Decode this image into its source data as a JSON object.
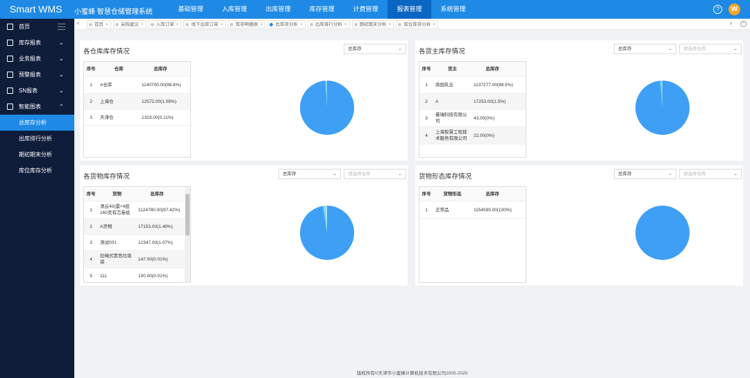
{
  "header": {
    "logo": "Smart WMS",
    "subtitle": "小蜜蜂 智慧仓储管理系统",
    "nav": [
      "基础管理",
      "入库管理",
      "出库管理",
      "库存管理",
      "计费管理",
      "报表管理",
      "系统管理"
    ],
    "active_nav_index": 5,
    "help_icon": "?",
    "avatar_letter": "W"
  },
  "sidebar": {
    "items": [
      {
        "label": "首页",
        "icon": "dashboard-icon"
      },
      {
        "label": "库存报表",
        "icon": "report-icon",
        "arrow": "⌄"
      },
      {
        "label": "业务报表",
        "icon": "business-icon",
        "arrow": "⌄"
      },
      {
        "label": "预警报表",
        "icon": "warning-icon",
        "arrow": "⌄"
      },
      {
        "label": "SN报表",
        "icon": "sn-icon",
        "arrow": "⌄"
      },
      {
        "label": "智能图表",
        "icon": "chart-icon",
        "arrow": "⌃"
      }
    ],
    "subitems": [
      "总库存分析",
      "出库排行分析",
      "期初期末分析",
      "库位库存分析"
    ],
    "active_sub_index": 0
  },
  "tabs": {
    "items": [
      "首页",
      "采购建议",
      "入库订单",
      "线下出库订单",
      "库存明细表",
      "总库存分析",
      "出库排行分析",
      "期初期末分析",
      "库位库存分析"
    ],
    "active_index": 5,
    "close": "×",
    "left": "‹",
    "right": "›"
  },
  "panels": {
    "warehouse": {
      "title": "各仓库库存情况",
      "select": "总库存",
      "headers": [
        "序号",
        "仓库",
        "总库存"
      ],
      "rows": [
        [
          "1",
          "A仓库",
          "1140700.00(98.8%)"
        ],
        [
          "2",
          "上海仓",
          "12572.00(1.09%)"
        ],
        [
          "3",
          "天津仓",
          "1323.00(0.11%)"
        ]
      ]
    },
    "owner": {
      "title": "各货主库存情况",
      "select": "总库存",
      "placeholder": "请选择仓库",
      "headers": [
        "序号",
        "货主",
        "总库存"
      ],
      "rows": [
        [
          "1",
          "商园乳业",
          "1137277.00(98.5%)"
        ],
        [
          "2",
          "A",
          "17253.00(1.5%)"
        ],
        [
          "3",
          "曼瑞科技有限公司",
          "43.00(0%)"
        ],
        [
          "4",
          "上海智慧工程技术服务有限公司",
          "22.00(0%)"
        ]
      ]
    },
    "goods": {
      "title": "各货物库存情况",
      "select": "总库存",
      "placeholder": "请选择仓库",
      "headers": [
        "序号",
        "货物",
        "总库存"
      ],
      "rows": [
        [
          "1",
          "清云40(雷+4层160克有芯卷纸",
          "1124780.00(97.42%)"
        ],
        [
          "2",
          "A货物",
          "17153.00(1.49%)"
        ],
        [
          "3",
          "测试001",
          "12347.00(1.07%)"
        ],
        [
          "4",
          "拉绳式黑色垃圾袋",
          "147.00(0.01%)"
        ],
        [
          "5",
          "111",
          "100.00(0.01%)"
        ]
      ]
    },
    "form": {
      "title": "货物形态库存情况",
      "select": "总库存",
      "placeholder": "请选择仓库",
      "headers": [
        "序号",
        "货物形态",
        "总库存"
      ],
      "rows": [
        [
          "1",
          "正常品",
          "1154595.00(100%)"
        ]
      ]
    }
  },
  "chart_data": [
    {
      "type": "pie",
      "categories": [
        "A仓库",
        "上海仓",
        "天津仓"
      ],
      "values": [
        98.8,
        1.09,
        0.11
      ],
      "colors": [
        "#3e9ff5",
        "#7fd1e8",
        "#aee4f0"
      ]
    },
    {
      "type": "pie",
      "categories": [
        "商园乳业",
        "A",
        "曼瑞科技有限公司",
        "上海智慧工程技术服务有限公司"
      ],
      "values": [
        98.5,
        1.5,
        0,
        0
      ],
      "colors": [
        "#3e9ff5",
        "#7fd1e8",
        "#aee4f0",
        "#c9eef5"
      ]
    },
    {
      "type": "pie",
      "categories": [
        "清云40(雷+4层160克有芯卷纸",
        "A货物",
        "测试001",
        "拉绳式黑色垃圾袋",
        "111"
      ],
      "values": [
        97.42,
        1.49,
        1.07,
        0.01,
        0.01
      ],
      "colors": [
        "#3e9ff5",
        "#7fd1e8",
        "#aee4f0",
        "#c9eef5",
        "#d6f3f8"
      ]
    },
    {
      "type": "pie",
      "categories": [
        "正常品"
      ],
      "values": [
        100
      ],
      "colors": [
        "#3e9ff5"
      ]
    }
  ],
  "footer": "版权所有©天津市小蜜蜂计算机技术有限公司2005-2020"
}
